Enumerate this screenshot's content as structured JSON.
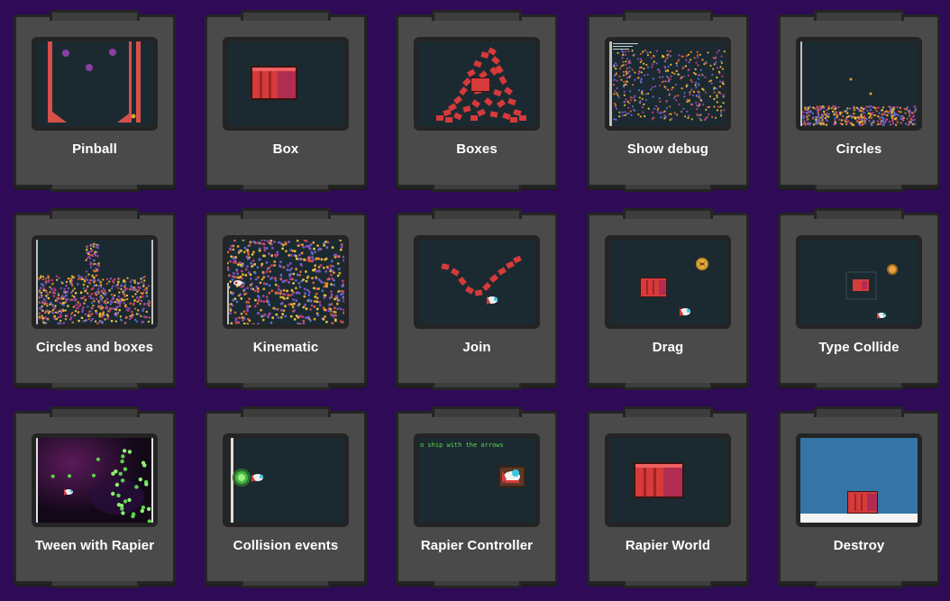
{
  "examples": [
    {
      "label": "Pinball",
      "scene": "pinball"
    },
    {
      "label": "Box",
      "scene": "box"
    },
    {
      "label": "Boxes",
      "scene": "boxes"
    },
    {
      "label": "Show debug",
      "scene": "showdebug"
    },
    {
      "label": "Circles",
      "scene": "circles"
    },
    {
      "label": "Circles and boxes",
      "scene": "circlesboxes"
    },
    {
      "label": "Kinematic",
      "scene": "kinematic"
    },
    {
      "label": "Join",
      "scene": "join"
    },
    {
      "label": "Drag",
      "scene": "drag"
    },
    {
      "label": "Type Collide",
      "scene": "typecollide"
    },
    {
      "label": "Tween with Rapier",
      "scene": "tween"
    },
    {
      "label": "Collision events",
      "scene": "collision"
    },
    {
      "label": "Rapier Controller",
      "scene": "controller",
      "overlay_text": "o ship with the arrows"
    },
    {
      "label": "Rapier World",
      "scene": "world"
    },
    {
      "label": "Destroy",
      "scene": "destroy"
    }
  ],
  "colors": {
    "page_background": "#2e0a57",
    "card": "#4a4a4a",
    "card_border": "#242424",
    "thumb_background": "#1b2a31",
    "box_red": "#d03a3a",
    "sky_blue": "#3475a5",
    "green_glow": "#5cd64a"
  }
}
